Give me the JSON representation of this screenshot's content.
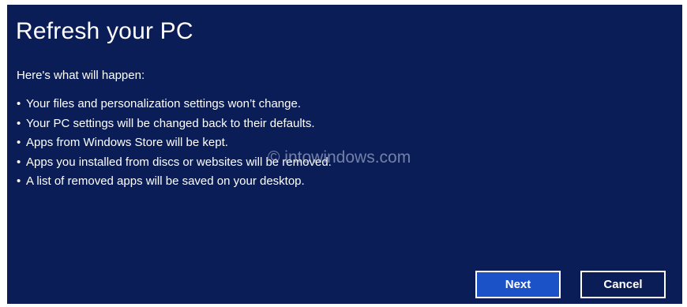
{
  "dialog": {
    "title": "Refresh your PC",
    "subtitle": "Here's what will happen:",
    "bullet_char": "•",
    "bullets": [
      "Your files and personalization settings won’t change.",
      "Your PC settings will be changed back to their defaults.",
      "Apps from Windows Store will be kept.",
      "Apps you installed from discs or websites will be removed.",
      "A list of removed apps will be saved on your desktop."
    ],
    "watermark": "© intowindows.com",
    "buttons": {
      "next_label": "Next",
      "cancel_label": "Cancel"
    }
  },
  "colors": {
    "background": "#0b1d56",
    "accent": "#1c52c7",
    "text": "#ffffff"
  }
}
